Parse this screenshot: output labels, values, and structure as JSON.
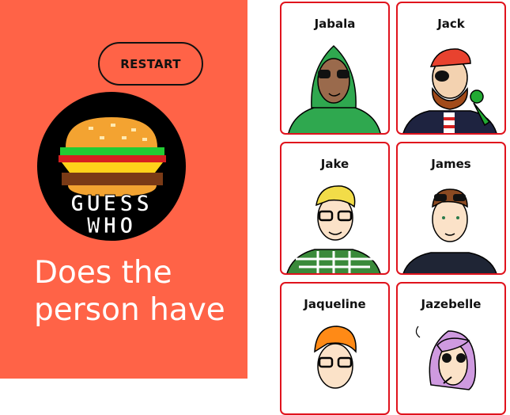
{
  "controls": {
    "restart_label": "RESTART"
  },
  "logo": {
    "line1": "GUESS",
    "line2": "WHO",
    "icon": "burger-icon"
  },
  "question": {
    "text": "Does the person have"
  },
  "colors": {
    "panel": "#ff6347",
    "card_border": "#e0131d",
    "text_dark": "#111111"
  },
  "cards": [
    {
      "name": "Jabala"
    },
    {
      "name": "Jack"
    },
    {
      "name": "Jake"
    },
    {
      "name": "James"
    },
    {
      "name": "Jaqueline"
    },
    {
      "name": "Jazebelle"
    }
  ]
}
